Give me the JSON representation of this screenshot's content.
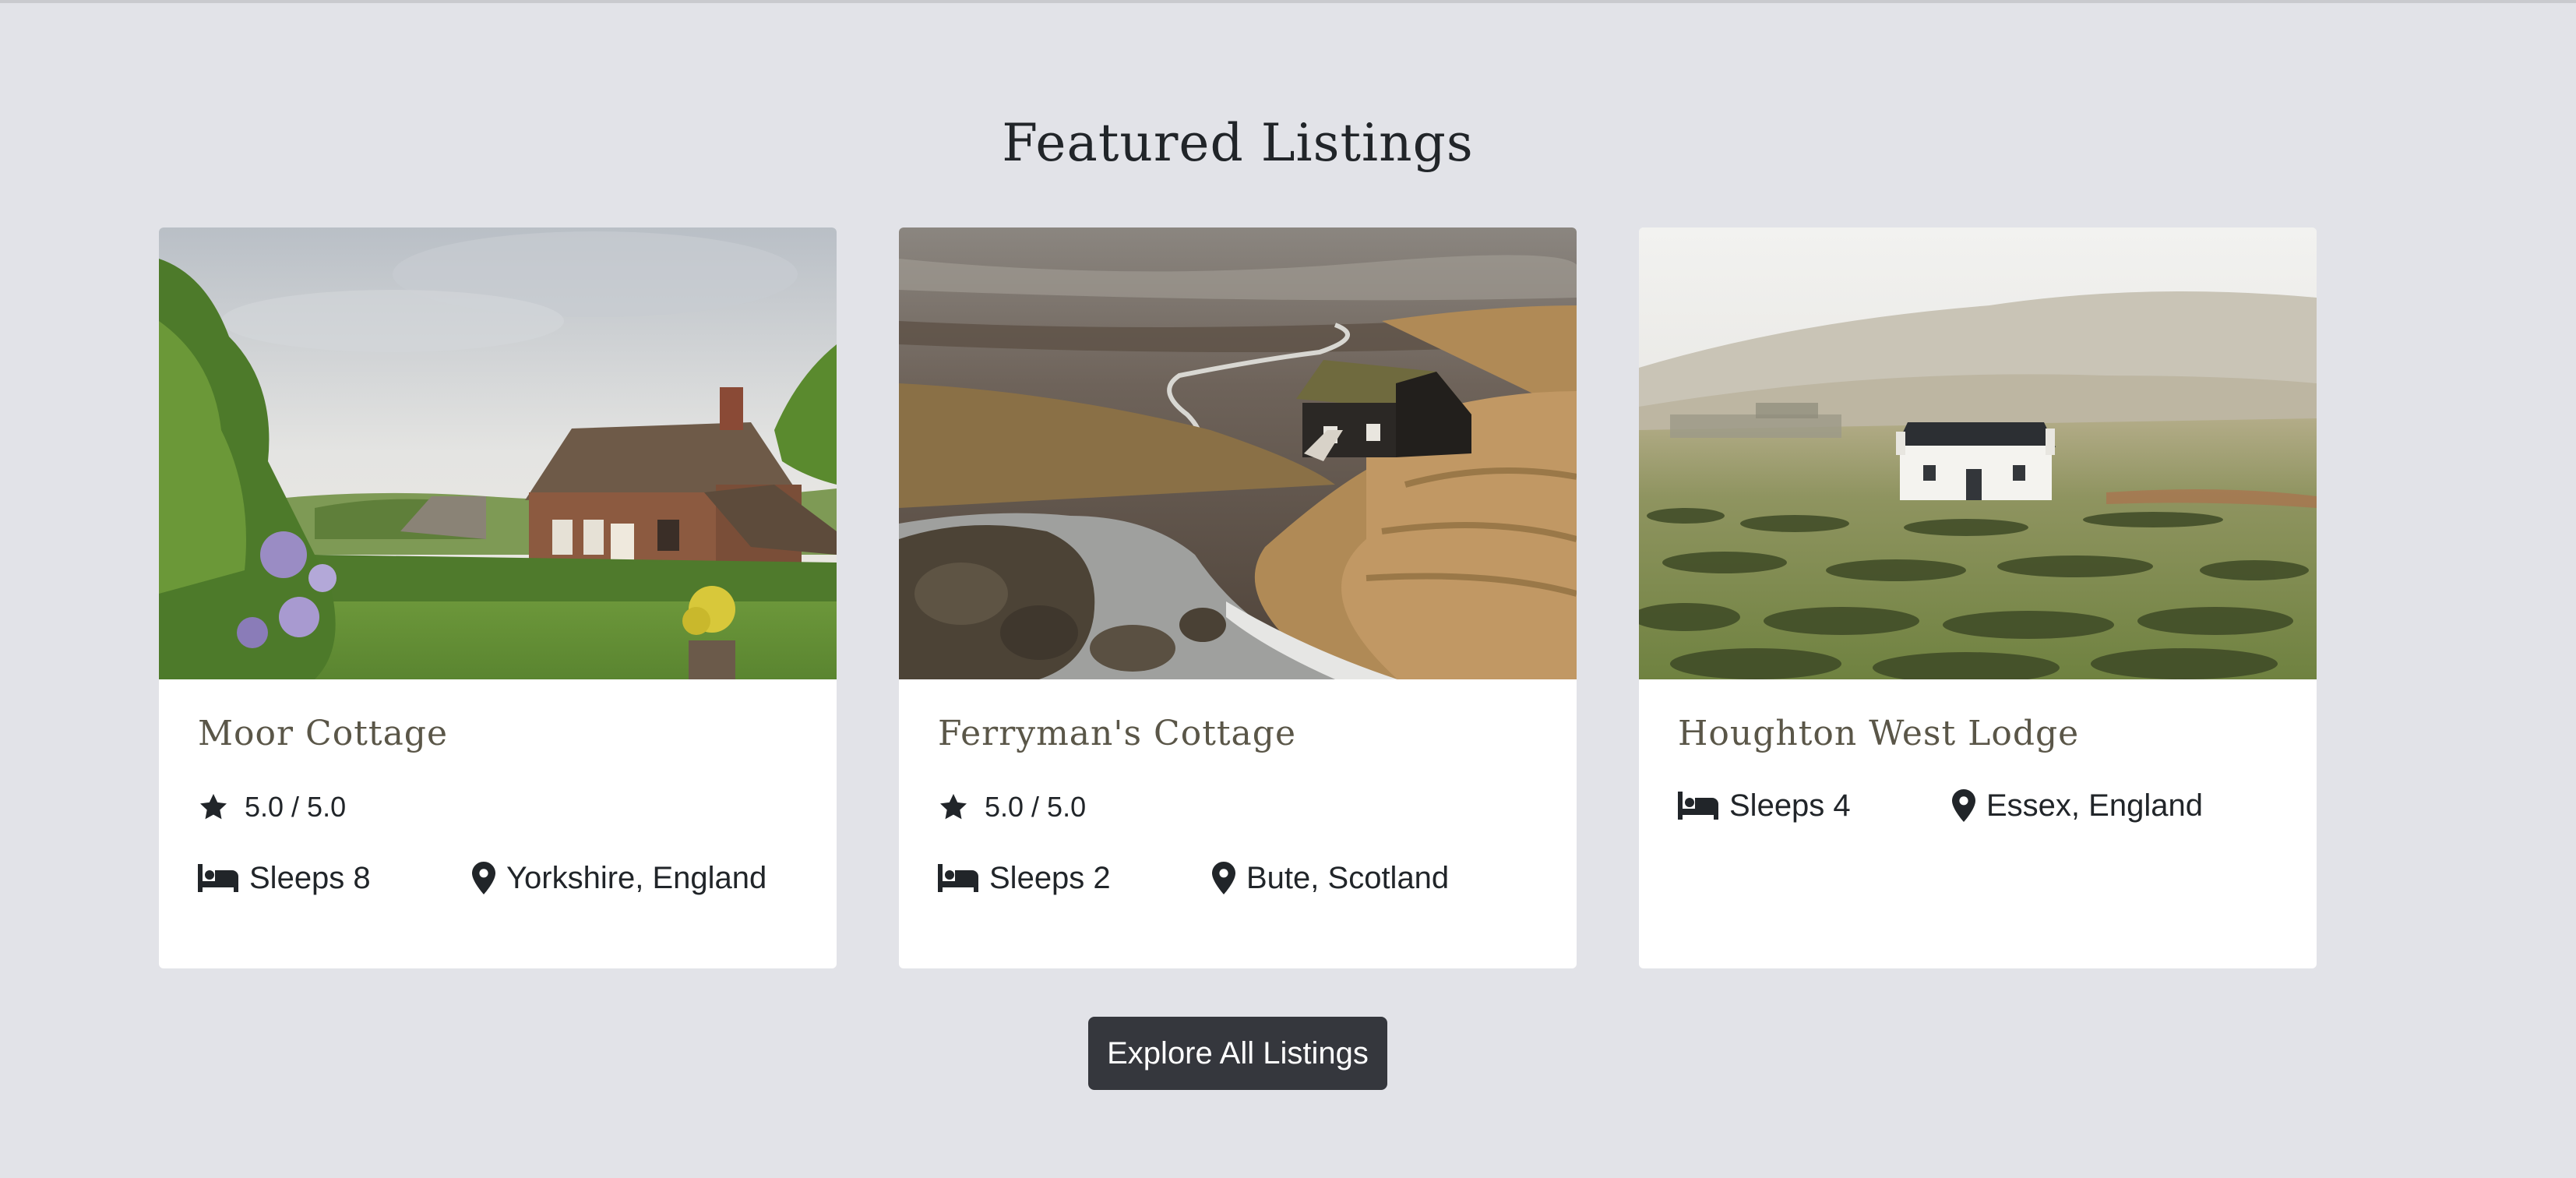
{
  "section": {
    "title": "Featured Listings"
  },
  "listings": [
    {
      "name": "Moor Cottage",
      "rating": "5.0 / 5.0",
      "sleeps": "Sleeps 8",
      "location": "Yorkshire, England",
      "image_subject": "brick cottage in a green garden"
    },
    {
      "name": "Ferryman's Cottage",
      "rating": "5.0 / 5.0",
      "sleeps": "Sleeps 2",
      "location": "Bute, Scotland",
      "image_subject": "dark turf-roof cottage above a rocky stream"
    },
    {
      "name": "Houghton West Lodge",
      "sleeps": "Sleeps 4",
      "location": "Essex, England",
      "image_subject": "white cottage on misty moorland"
    }
  ],
  "actions": {
    "explore_label": "Explore All Listings"
  },
  "icons": {
    "rating": "star-icon",
    "sleeps": "bed-icon",
    "location": "map-pin-icon"
  },
  "colors": {
    "page_background": "#e2e3e8",
    "card_background": "#ffffff",
    "card_title": "#5a5648",
    "button_background": "#35373d",
    "button_text": "#ffffff"
  }
}
